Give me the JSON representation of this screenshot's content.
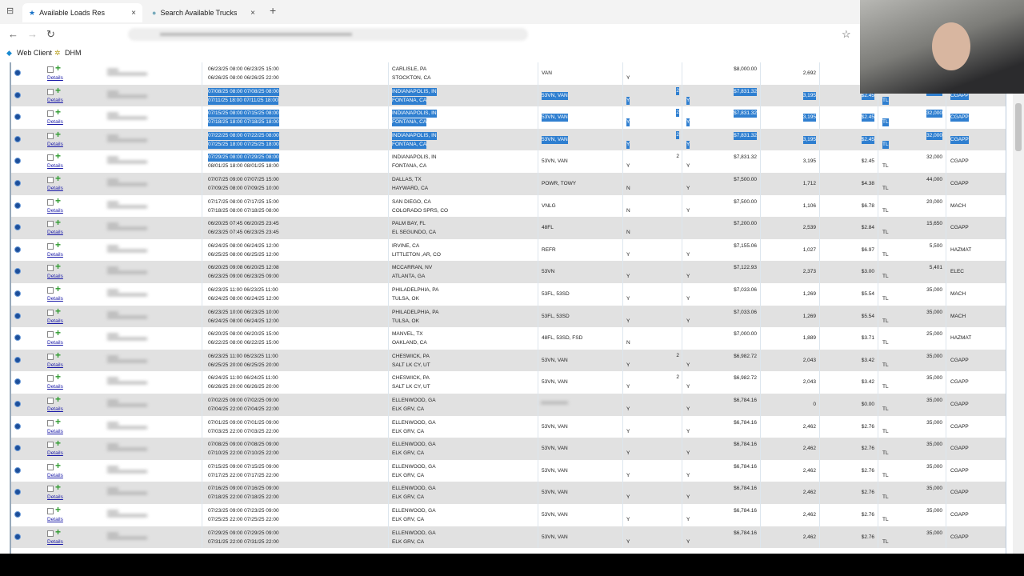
{
  "browser": {
    "tabs": [
      {
        "label": "Available Loads Res",
        "icon": "star-icon"
      },
      {
        "label": "Search Available Trucks",
        "icon": "globe-icon"
      }
    ],
    "bookmarks": [
      "Web Client",
      "DHM"
    ]
  },
  "table": {
    "details_label": "Details",
    "highlight_color": "#2f7fd0",
    "rows": [
      {
        "p": [
          "06/23/25 08:00  06/23/25 15:00",
          "06/26/25 08:00  06/26/25 22:00"
        ],
        "o": "CARLISLE, PA",
        "d": "STOCKTON, CA",
        "eq": "VAN",
        "f1": "Y",
        "n": "",
        "f2": "",
        "price": "$8,000.00",
        "mi": "2,692",
        "rate": "",
        "mode": "",
        "wt": "",
        "com": "",
        "sel": 0
      },
      {
        "p": [
          "07/08/25 08:00  07/08/25 08:00",
          "07/11/25 18:00  07/11/25 18:00"
        ],
        "o": "INDIANAPOLIS, IN",
        "d": "FONTANA, CA",
        "eq": "53VN, VAN",
        "f1": "Y",
        "n": "2",
        "f2": "Y",
        "price": "$7,831.32",
        "mi": "3,195",
        "rate": "$2.45",
        "mode": "TL",
        "wt": "32,000",
        "com": "CGAPP",
        "sel": 2
      },
      {
        "p": [
          "07/15/25 08:00  07/15/25 08:00",
          "07/18/25 18:00  07/18/25 18:00"
        ],
        "o": "INDIANAPOLIS, IN",
        "d": "FONTANA, CA",
        "eq": "53VN, VAN",
        "f1": "Y",
        "n": "2",
        "f2": "Y",
        "price": "$7,831.32",
        "mi": "3,195",
        "rate": "$2.45",
        "mode": "TL",
        "wt": "32,000",
        "com": "CGAPP",
        "sel": 2
      },
      {
        "p": [
          "07/22/25 08:00  07/22/25 08:00",
          "07/25/25 18:00  07/25/25 18:00"
        ],
        "o": "INDIANAPOLIS, IN",
        "d": "FONTANA, CA",
        "eq": "53VN, VAN",
        "f1": "Y",
        "n": "2",
        "f2": "Y",
        "price": "$7,831.32",
        "mi": "3,195",
        "rate": "$2.45",
        "mode": "TL",
        "wt": "32,000",
        "com": "CGAPP",
        "sel": 2
      },
      {
        "p": [
          "07/29/25 08:00  07/29/25 08:00",
          "08/01/25 18:00  08/01/25 18:00"
        ],
        "o": "INDIANAPOLIS, IN",
        "d": "FONTANA, CA",
        "eq": "53VN, VAN",
        "f1": "Y",
        "n": "2",
        "f2": "Y",
        "price": "$7,831.32",
        "mi": "3,195",
        "rate": "$2.45",
        "mode": "TL",
        "wt": "32,000",
        "com": "CGAPP",
        "sel": 1
      },
      {
        "p": [
          "07/07/25 09:00  07/07/25 15:00",
          "07/09/25 08:00  07/09/25 10:00"
        ],
        "o": "DALLAS, TX",
        "d": "HAYWARD, CA",
        "eq": "POWR, TOWY",
        "f1": "N",
        "n": "",
        "f2": "Y",
        "price": "$7,500.00",
        "mi": "1,712",
        "rate": "$4.38",
        "mode": "TL",
        "wt": "44,000",
        "com": "CGAPP",
        "sel": 0
      },
      {
        "p": [
          "07/17/25 08:00  07/17/25 15:00",
          "07/18/25 08:00  07/18/25 08:00"
        ],
        "o": "SAN DIEGO, CA",
        "d": "COLORADO SPRS, CO",
        "eq": "VNLG",
        "f1": "N",
        "n": "",
        "f2": "Y",
        "price": "$7,500.00",
        "mi": "1,106",
        "rate": "$6.78",
        "mode": "TL",
        "wt": "20,000",
        "com": "MACH",
        "sel": 0
      },
      {
        "p": [
          "06/20/25 07:45  06/20/25 23:45",
          "06/23/25 07:45  06/23/25 23:45"
        ],
        "o": "PALM BAY, FL",
        "d": "EL SEGUNDO, CA",
        "eq": "48FL",
        "f1": "N",
        "n": "",
        "f2": "",
        "price": "$7,200.00",
        "mi": "2,539",
        "rate": "$2.84",
        "mode": "TL",
        "wt": "15,650",
        "com": "CGAPP",
        "sel": 0
      },
      {
        "p": [
          "06/24/25 08:00  06/24/25 12:00",
          "06/25/25 08:00  06/25/25 12:00"
        ],
        "o": "IRVINE, CA",
        "d": "LITTLETON ,AR, CO",
        "eq": "REFR",
        "f1": "Y",
        "n": "",
        "f2": "Y",
        "price": "$7,155.06",
        "mi": "1,027",
        "rate": "$6.97",
        "mode": "TL",
        "wt": "5,500",
        "com": "HAZMAT",
        "sel": 0
      },
      {
        "p": [
          "06/20/25 09:08  06/20/25 12:08",
          "06/23/25 09:00  06/23/25 09:00"
        ],
        "o": "MCCARRAN, NV",
        "d": "ATLANTA, GA",
        "eq": "53VN",
        "f1": "Y",
        "n": "",
        "f2": "Y",
        "price": "$7,122.93",
        "mi": "2,373",
        "rate": "$3.00",
        "mode": "TL",
        "wt": "5,401",
        "com": "ELEC",
        "sel": 0
      },
      {
        "p": [
          "06/23/25 11:00  06/23/25 11:00",
          "06/24/25 08:00  06/24/25 12:00"
        ],
        "o": "PHILADELPHIA, PA",
        "d": "TULSA, OK",
        "eq": "53FL, 53SD",
        "f1": "Y",
        "n": "",
        "f2": "Y",
        "price": "$7,033.06",
        "mi": "1,269",
        "rate": "$5.54",
        "mode": "TL",
        "wt": "35,000",
        "com": "MACH",
        "sel": 0
      },
      {
        "p": [
          "06/23/25 10:00  06/23/25 10:00",
          "06/24/25 08:00  06/24/25 12:00"
        ],
        "o": "PHILADELPHIA, PA",
        "d": "TULSA, OK",
        "eq": "53FL, 53SD",
        "f1": "Y",
        "n": "",
        "f2": "Y",
        "price": "$7,033.06",
        "mi": "1,269",
        "rate": "$5.54",
        "mode": "TL",
        "wt": "35,000",
        "com": "MACH",
        "sel": 0
      },
      {
        "p": [
          "06/20/25 08:00  06/20/25 15:00",
          "06/22/25 08:00  06/22/25 15:00"
        ],
        "o": "MANVEL, TX",
        "d": "OAKLAND, CA",
        "eq": "48FL, 53SD, FSD",
        "f1": "N",
        "n": "",
        "f2": "",
        "price": "$7,000.00",
        "mi": "1,889",
        "rate": "$3.71",
        "mode": "TL",
        "wt": "25,000",
        "com": "HAZMAT",
        "sel": 0
      },
      {
        "p": [
          "06/23/25 11:00  06/23/25 11:00",
          "06/25/25 20:00  06/25/25 20:00"
        ],
        "o": "CHESWICK, PA",
        "d": "SALT LK CY, UT",
        "eq": "53VN, VAN",
        "f1": "Y",
        "n": "2",
        "f2": "Y",
        "price": "$6,982.72",
        "mi": "2,043",
        "rate": "$3.42",
        "mode": "TL",
        "wt": "35,000",
        "com": "CGAPP",
        "sel": 0
      },
      {
        "p": [
          "06/24/25 11:00  06/24/25 11:00",
          "06/26/25 20:00  06/26/25 20:00"
        ],
        "o": "CHESWICK, PA",
        "d": "SALT LK CY, UT",
        "eq": "53VN, VAN",
        "f1": "Y",
        "n": "2",
        "f2": "Y",
        "price": "$6,982.72",
        "mi": "2,043",
        "rate": "$3.42",
        "mode": "TL",
        "wt": "35,000",
        "com": "CGAPP",
        "sel": 0
      },
      {
        "p": [
          "07/02/25 09:00  07/02/25 09:00",
          "07/04/25 22:00  07/04/25 22:00"
        ],
        "o": "ELLENWOOD, GA",
        "d": "ELK GRV, CA",
        "eq": "",
        "f1": "Y",
        "n": "",
        "f2": "Y",
        "price": "$6,784.16",
        "mi": "0",
        "rate": "$0.00",
        "mode": "TL",
        "wt": "35,000",
        "com": "CGAPP",
        "sel": 0
      },
      {
        "p": [
          "07/01/25 09:00  07/01/25 09:00",
          "07/03/25 22:00  07/03/25 22:00"
        ],
        "o": "ELLENWOOD, GA",
        "d": "ELK GRV, CA",
        "eq": "53VN, VAN",
        "f1": "Y",
        "n": "",
        "f2": "Y",
        "price": "$6,784.16",
        "mi": "2,462",
        "rate": "$2.76",
        "mode": "TL",
        "wt": "35,000",
        "com": "CGAPP",
        "sel": 0
      },
      {
        "p": [
          "07/08/25 09:00  07/08/25 09:00",
          "07/10/25 22:00  07/10/25 22:00"
        ],
        "o": "ELLENWOOD, GA",
        "d": "ELK GRV, CA",
        "eq": "53VN, VAN",
        "f1": "Y",
        "n": "",
        "f2": "Y",
        "price": "$6,784.16",
        "mi": "2,462",
        "rate": "$2.76",
        "mode": "TL",
        "wt": "35,000",
        "com": "CGAPP",
        "sel": 0
      },
      {
        "p": [
          "07/15/25 09:00  07/15/25 09:00",
          "07/17/25 22:00  07/17/25 22:00"
        ],
        "o": "ELLENWOOD, GA",
        "d": "ELK GRV, CA",
        "eq": "53VN, VAN",
        "f1": "Y",
        "n": "",
        "f2": "Y",
        "price": "$6,784.16",
        "mi": "2,462",
        "rate": "$2.76",
        "mode": "TL",
        "wt": "35,000",
        "com": "CGAPP",
        "sel": 0
      },
      {
        "p": [
          "07/16/25 09:00  07/16/25 09:00",
          "07/18/25 22:00  07/18/25 22:00"
        ],
        "o": "ELLENWOOD, GA",
        "d": "ELK GRV, CA",
        "eq": "53VN, VAN",
        "f1": "Y",
        "n": "",
        "f2": "Y",
        "price": "$6,784.16",
        "mi": "2,462",
        "rate": "$2.76",
        "mode": "TL",
        "wt": "35,000",
        "com": "CGAPP",
        "sel": 0
      },
      {
        "p": [
          "07/23/25 09:00  07/23/25 09:00",
          "07/25/25 22:00  07/25/25 22:00"
        ],
        "o": "ELLENWOOD, GA",
        "d": "ELK GRV, CA",
        "eq": "53VN, VAN",
        "f1": "Y",
        "n": "",
        "f2": "Y",
        "price": "$6,784.16",
        "mi": "2,462",
        "rate": "$2.76",
        "mode": "TL",
        "wt": "35,000",
        "com": "CGAPP",
        "sel": 0
      },
      {
        "p": [
          "07/29/25 09:00  07/29/25 09:00",
          "07/31/25 22:00  07/31/25 22:00"
        ],
        "o": "ELLENWOOD, GA",
        "d": "ELK GRV, CA",
        "eq": "53VN, VAN",
        "f1": "Y",
        "n": "",
        "f2": "Y",
        "price": "$6,784.16",
        "mi": "2,462",
        "rate": "$2.76",
        "mode": "TL",
        "wt": "35,000",
        "com": "CGAPP",
        "sel": 0
      }
    ]
  }
}
